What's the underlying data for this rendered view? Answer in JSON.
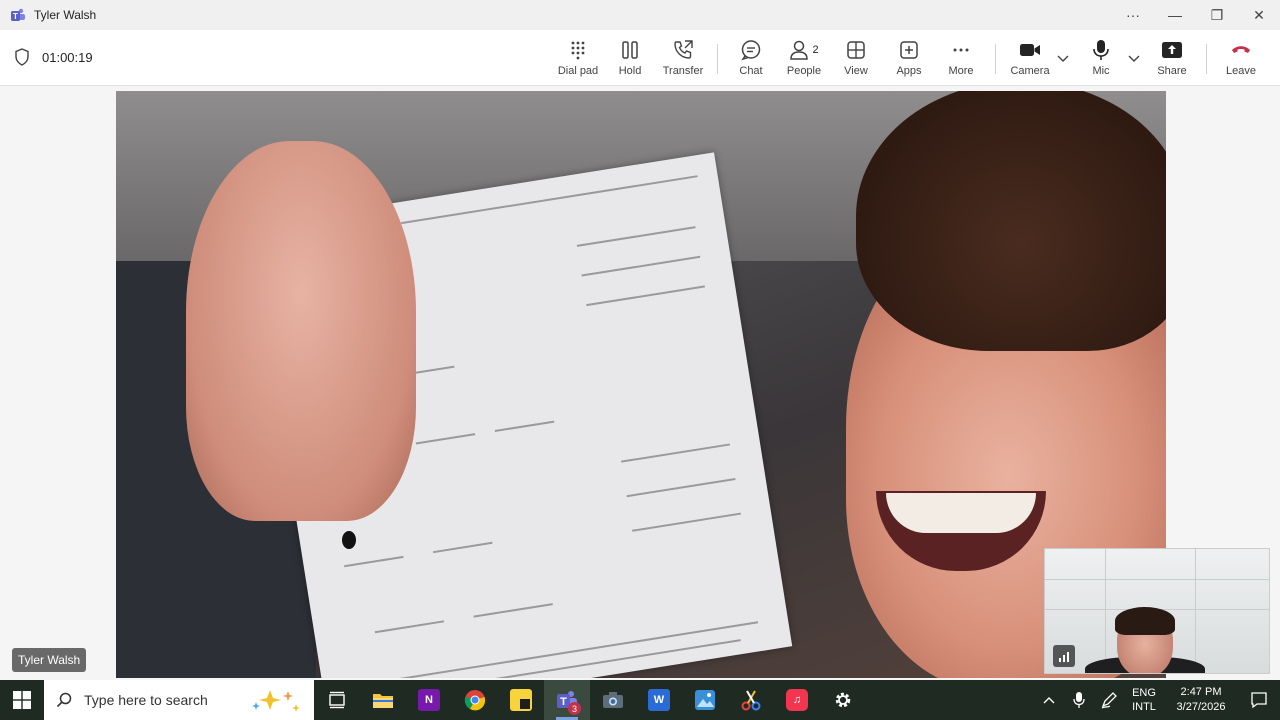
{
  "window": {
    "title": "Tyler Walsh"
  },
  "call": {
    "duration": "01:00:19"
  },
  "toolbar": {
    "dialpad": "Dial pad",
    "hold": "Hold",
    "transfer": "Transfer",
    "chat": "Chat",
    "people": "People",
    "people_count": "2",
    "view": "View",
    "apps": "Apps",
    "more": "More",
    "camera": "Camera",
    "mic": "Mic",
    "share": "Share",
    "leave": "Leave"
  },
  "video": {
    "participant_name": "Tyler Walsh"
  },
  "taskbar": {
    "search_placeholder": "Type here to search",
    "teams_badge": "3",
    "lang_top": "ENG",
    "lang_bottom": "INTL",
    "time": "2:47 PM",
    "date": "3/27/2026"
  },
  "colors": {
    "leave_red": "#c4314b",
    "taskbar_bg": "#1e2a22",
    "teams_purple": "#5b5fc7"
  }
}
